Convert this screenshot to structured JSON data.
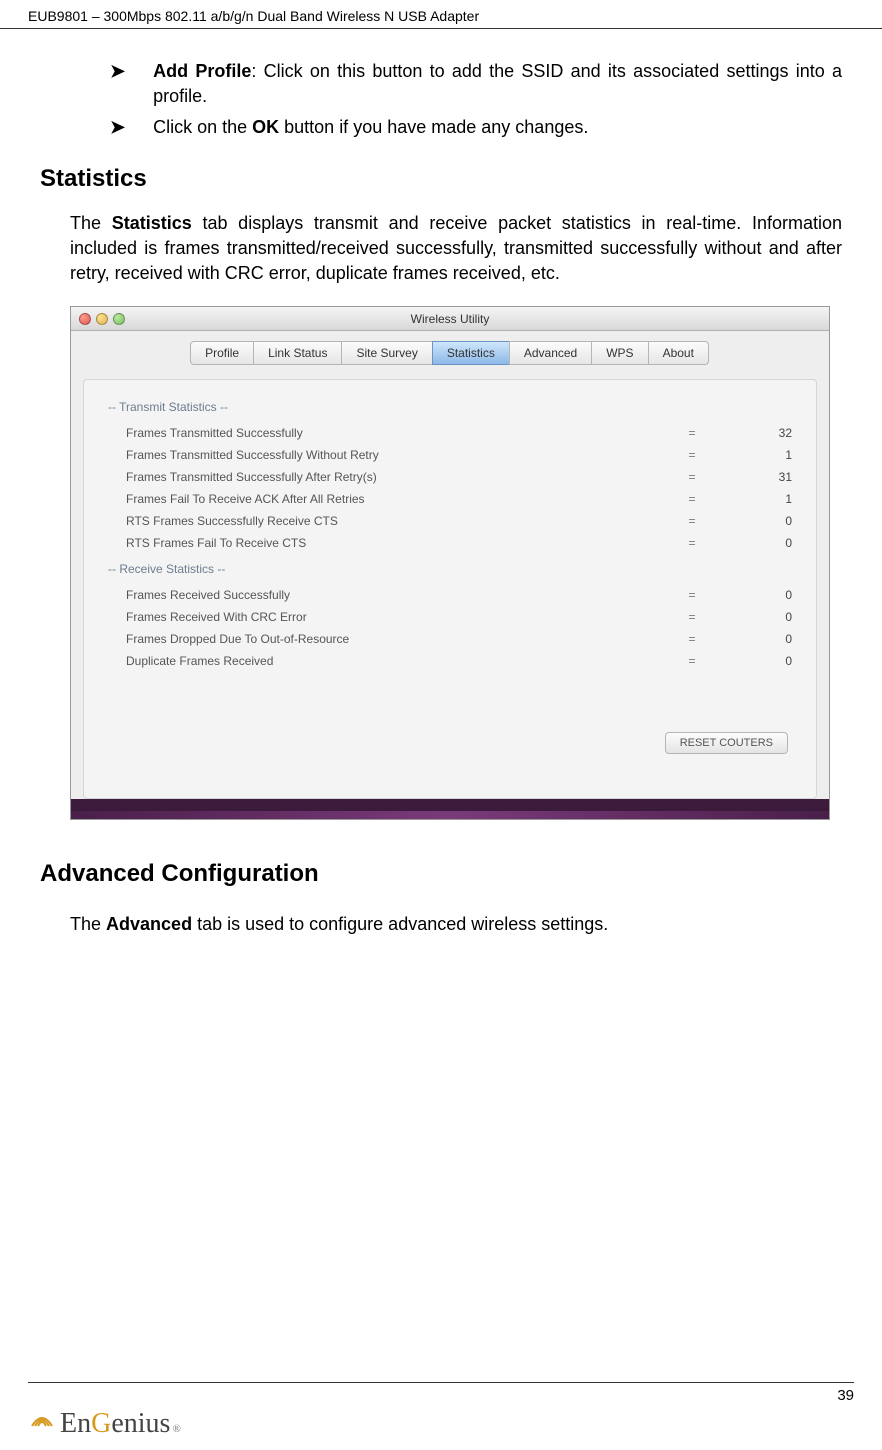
{
  "header": {
    "product": "EUB9801 – 300Mbps 802.11 a/b/g/n Dual Band Wireless N USB Adapter"
  },
  "bullets": {
    "addProfile": {
      "label": "Add Profile",
      "text": ": Click on this button to add the SSID and its associated settings into a profile."
    },
    "okLine": {
      "prefix": "Click on the ",
      "bold": "OK",
      "suffix": " button if you have made any changes."
    }
  },
  "statistics": {
    "heading": "Statistics",
    "paraPrefix": "The ",
    "paraBold": "Statistics",
    "paraSuffix": " tab displays transmit and receive packet statistics in real-time. Information included is frames transmitted/received successfully, transmitted successfully without and after retry, received with CRC error, duplicate frames received, etc."
  },
  "window": {
    "title": "Wireless Utility",
    "tabs": [
      "Profile",
      "Link Status",
      "Site Survey",
      "Statistics",
      "Advanced",
      "WPS",
      "About"
    ],
    "activeTab": "Statistics",
    "transmitHeading": "-- Transmit Statistics --",
    "transmitRows": [
      {
        "label": "Frames Transmitted Successfully",
        "val": "32"
      },
      {
        "label": "Frames Transmitted Successfully Without Retry",
        "val": "1"
      },
      {
        "label": "Frames Transmitted Successfully After Retry(s)",
        "val": "31"
      },
      {
        "label": "Frames Fail To Receive ACK After All Retries",
        "val": "1"
      },
      {
        "label": "RTS Frames Successfully Receive CTS",
        "val": "0"
      },
      {
        "label": "RTS Frames Fail To Receive CTS",
        "val": "0"
      }
    ],
    "receiveHeading": "-- Receive Statistics --",
    "receiveRows": [
      {
        "label": "Frames Received Successfully",
        "val": "0"
      },
      {
        "label": "Frames Received With CRC Error",
        "val": "0"
      },
      {
        "label": "Frames Dropped Due To Out-of-Resource",
        "val": "0"
      },
      {
        "label": "Duplicate Frames Received",
        "val": "0"
      }
    ],
    "resetLabel": "RESET COUTERS"
  },
  "advanced": {
    "heading": "Advanced Configuration",
    "paraPrefix": "The ",
    "paraBold": "Advanced",
    "paraSuffix": " tab is used to configure advanced wireless settings."
  },
  "footer": {
    "pageNum": "39",
    "logoText1": "En",
    "logoText2": "G",
    "logoText3": "enius"
  }
}
